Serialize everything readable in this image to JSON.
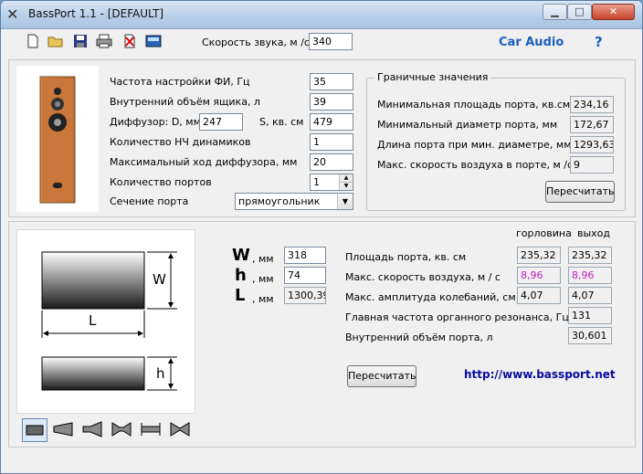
{
  "window": {
    "title": "BassPort 1.1 - [DEFAULT]"
  },
  "toolbar": {
    "icons": [
      "new-file-icon",
      "open-folder-icon",
      "save-icon",
      "print-icon",
      "delete-icon",
      "calculator-icon"
    ],
    "sound_speed_label": "Скорость звука, м /с",
    "sound_speed_value": "340",
    "brand_link": "Car Audio",
    "help_label": "?"
  },
  "params": {
    "tuning_freq_label": "Частота настройки ФИ, Гц",
    "tuning_freq_value": "35",
    "box_volume_label": "Внутренний объём ящика, л",
    "box_volume_value": "39",
    "diffuser_d_label": "Диффузор: D, мм",
    "diffuser_d_value": "247",
    "diffuser_s_label": "S, кв. см",
    "diffuser_s_value": "479",
    "woofer_count_label": "Количество НЧ динамиков",
    "woofer_count_value": "1",
    "excursion_label": "Максимальный ход диффузора, мм",
    "excursion_value": "20",
    "port_count_label": "Количество портов",
    "port_count_value": "1",
    "port_section_label": "Сечение порта",
    "port_section_value": "прямоугольник"
  },
  "limits": {
    "title": "Граничные значения",
    "min_area_label": "Минимальная площадь порта, кв.см",
    "min_area_value": "234,16",
    "min_diameter_label": "Минимальный диаметр порта, мм",
    "min_diameter_value": "172,67",
    "port_length_label": "Длина порта при мин. диаметре, мм",
    "port_length_value": "1293,63",
    "max_air_speed_label": "Макс. скорость воздуха в порте, м /с",
    "max_air_speed_value": "9",
    "recalc_button": "Пересчитать"
  },
  "port": {
    "diagram_w": "W",
    "diagram_l": "L",
    "diagram_h": "h",
    "w_letter": "W",
    "h_letter": "h",
    "l_letter": "L",
    "unit_mm": ", мм",
    "w_value": "318",
    "h_value": "74",
    "l_value": "1300,39",
    "col_throat": "горловина",
    "col_exit": "выход",
    "area_label": "Площадь порта, кв. см",
    "area_throat": "235,32",
    "area_exit": "235,32",
    "speed_label": "Макс. скорость воздуха, м / с",
    "speed_throat": "8,96",
    "speed_exit": "8,96",
    "amplitude_label": "Макс. амплитуда колебаний, см",
    "amplitude_throat": "4,07",
    "amplitude_exit": "4,07",
    "organ_freq_label": "Главная частота органного резонанса, Гц",
    "organ_freq_value": "131",
    "port_volume_label": "Внутренний объём порта, л",
    "port_volume_value": "30,601",
    "recalc_button": "Пересчитать",
    "website": "http://www.bassport.net"
  },
  "colors": {
    "link": "#1a5fc0",
    "website": "#0a0aa0",
    "highlight_value": "#c020c0"
  }
}
